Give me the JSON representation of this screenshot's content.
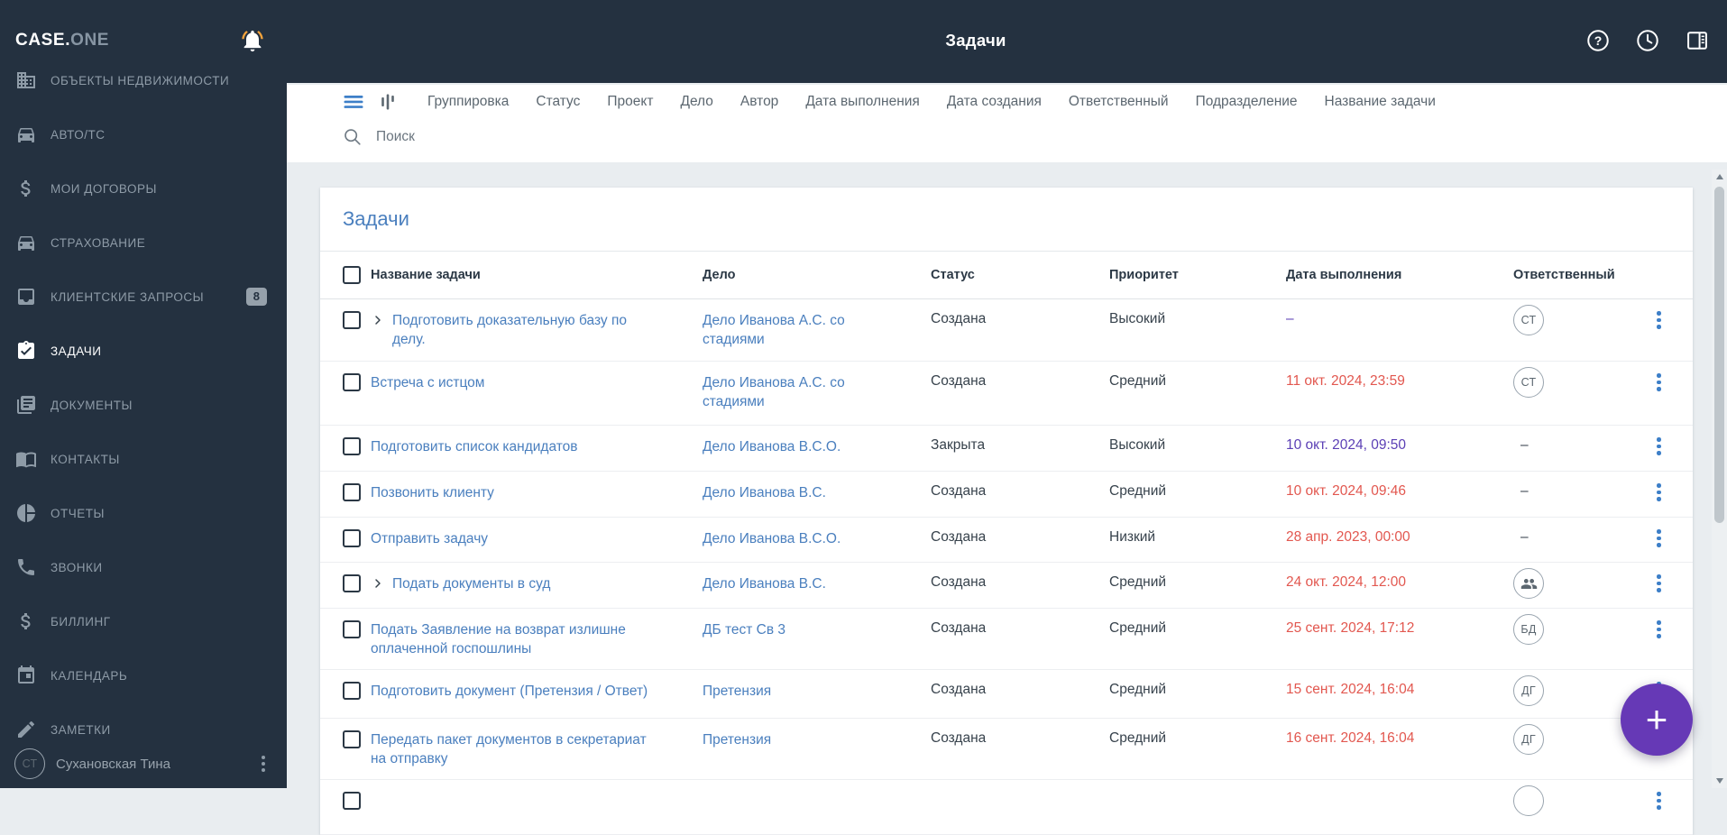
{
  "app": {
    "logo_primary": "CASE.",
    "logo_secondary": "ONE",
    "page_title": "Задачи"
  },
  "sidebar": {
    "items": [
      {
        "label": "ОБЪЕКТЫ НЕДВИЖИМОСТИ",
        "icon": "building-icon",
        "active": false
      },
      {
        "label": "АВТО/ТС",
        "icon": "car-icon",
        "active": false
      },
      {
        "label": "МОИ ДОГОВОРЫ",
        "icon": "dollar-icon",
        "active": false
      },
      {
        "label": "СТРАХОВАНИЕ",
        "icon": "car-icon",
        "active": false
      },
      {
        "label": "КЛИЕНТСКИЕ ЗАПРОСЫ",
        "icon": "inbox-icon",
        "active": false,
        "badge": "8"
      },
      {
        "label": "ЗАДАЧИ",
        "icon": "tasks-icon",
        "active": true
      },
      {
        "label": "ДОКУМЕНТЫ",
        "icon": "documents-icon",
        "active": false
      },
      {
        "label": "КОНТАКТЫ",
        "icon": "contacts-icon",
        "active": false
      },
      {
        "label": "ОТЧЕТЫ",
        "icon": "reports-icon",
        "active": false
      },
      {
        "label": "ЗВОНКИ",
        "icon": "phone-icon",
        "active": false
      },
      {
        "label": "БИЛЛИНГ",
        "icon": "dollar-icon",
        "active": false
      },
      {
        "label": "КАЛЕНДАРЬ",
        "icon": "calendar-icon",
        "active": false
      },
      {
        "label": "ЗАМЕТКИ",
        "icon": "pencil-icon",
        "active": false
      }
    ],
    "user": {
      "initials": "СТ",
      "name": "Сухановская Тина"
    }
  },
  "topbar": {
    "icons": [
      "help-icon",
      "history-icon",
      "layout-panel-icon"
    ]
  },
  "toolbar": {
    "filters": [
      "Группировка",
      "Статус",
      "Проект",
      "Дело",
      "Автор",
      "Дата выполнения",
      "Дата создания",
      "Ответственный",
      "Подразделение",
      "Название задачи"
    ]
  },
  "search": {
    "placeholder": "Поиск"
  },
  "tasks": {
    "card_title": "Задачи",
    "columns": [
      "Название задачи",
      "Дело",
      "Статус",
      "Приоритет",
      "Дата выполнения",
      "Ответственный"
    ],
    "rows": [
      {
        "name": "Подготовить доказательную базу по делу.",
        "expandable": true,
        "case": "Дело Иванова А.С. со стадиями",
        "status": "Создана",
        "priority": "Высокий",
        "due": "–",
        "due_color": "purple",
        "responsible": "СТ"
      },
      {
        "name": "Встреча с истцом",
        "expandable": false,
        "case": "Дело Иванова А.С. со стадиями",
        "status": "Создана",
        "priority": "Средний",
        "due": "11 окт. 2024, 23:59",
        "due_color": "red",
        "responsible": "СТ"
      },
      {
        "name": "Подготовить список кандидатов",
        "expandable": false,
        "case": "Дело Иванова В.С.О.",
        "status": "Закрыта",
        "priority": "Высокий",
        "due": "10 окт. 2024, 09:50",
        "due_color": "purple",
        "responsible": "–"
      },
      {
        "name": "Позвонить клиенту",
        "expandable": false,
        "case": "Дело Иванова В.С.",
        "status": "Создана",
        "priority": "Средний",
        "due": "10 окт. 2024, 09:46",
        "due_color": "red",
        "responsible": "–"
      },
      {
        "name": "Отправить задачу",
        "expandable": false,
        "case": "Дело Иванова В.С.О.",
        "status": "Создана",
        "priority": "Низкий",
        "due": "28 апр. 2023, 00:00",
        "due_color": "red",
        "responsible": "–"
      },
      {
        "name": "Подать документы в суд",
        "expandable": true,
        "case": "Дело Иванова В.С.",
        "status": "Создана",
        "priority": "Средний",
        "due": "24 окт. 2024, 12:00",
        "due_color": "red",
        "responsible": "group"
      },
      {
        "name": "Подать Заявление на возврат излишне оплаченной госпошлины",
        "expandable": false,
        "case": "ДБ тест Св 3",
        "status": "Создана",
        "priority": "Средний",
        "due": "25 сент. 2024, 17:12",
        "due_color": "red",
        "responsible": "БД"
      },
      {
        "name": "Подготовить документ (Претензия / Ответ)",
        "expandable": false,
        "case": "Претензия",
        "status": "Создана",
        "priority": "Средний",
        "due": "15 сент. 2024, 16:04",
        "due_color": "red",
        "responsible": "ДГ"
      },
      {
        "name": "Передать пакет документов в секретариат на отправку",
        "expandable": false,
        "case": "Претензия",
        "status": "Создана",
        "priority": "Средний",
        "due": "16 сент. 2024, 16:04",
        "due_color": "red",
        "responsible": "ДГ"
      },
      {
        "name": "",
        "expandable": false,
        "case": "",
        "status": "",
        "priority": "",
        "due": "",
        "due_color": "",
        "responsible": ""
      }
    ]
  },
  "fab": {
    "label": "+"
  },
  "colors": {
    "sidebar_bg": "#243140",
    "link_blue": "#4A7FBE",
    "accent_blue": "#3D7FC8",
    "danger_red": "#E2574F",
    "overdue_purple": "#5B3FB5",
    "fab_purple": "#6639B6",
    "bell_orange": "#F5A33B"
  }
}
